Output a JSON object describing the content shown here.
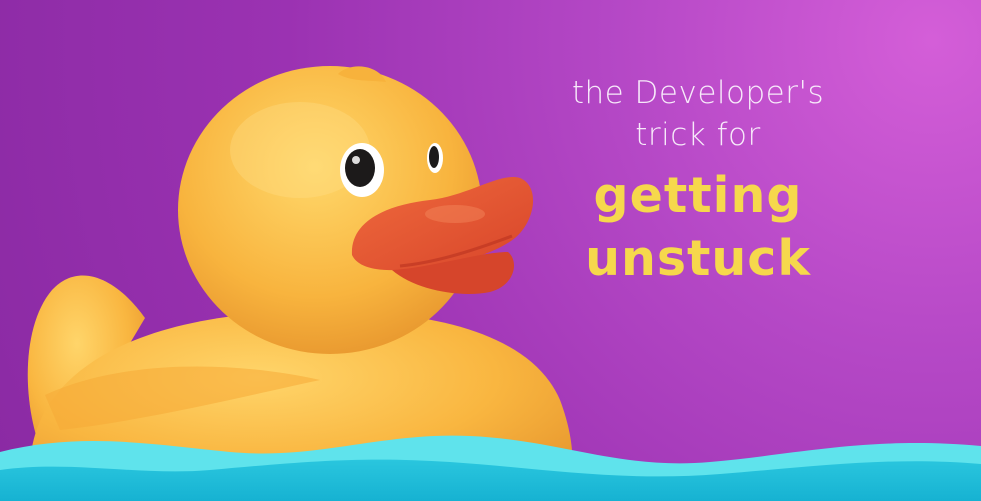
{
  "headline": {
    "line1": "the Developer's",
    "line2": "trick for",
    "line3": "getting",
    "line4": "unstuck"
  },
  "colors": {
    "background_start": "#d45ed8",
    "background_end": "#8a2aa3",
    "headline_light": "#f7eafa",
    "headline_accent": "#f6d84c",
    "duck_body": "#f9b640",
    "duck_beak": "#e5552f",
    "water_light": "#5fe3ec",
    "water_dark": "#1ebdd8"
  },
  "illustration": {
    "subject": "rubber-duck",
    "foreground": "water-waves"
  }
}
